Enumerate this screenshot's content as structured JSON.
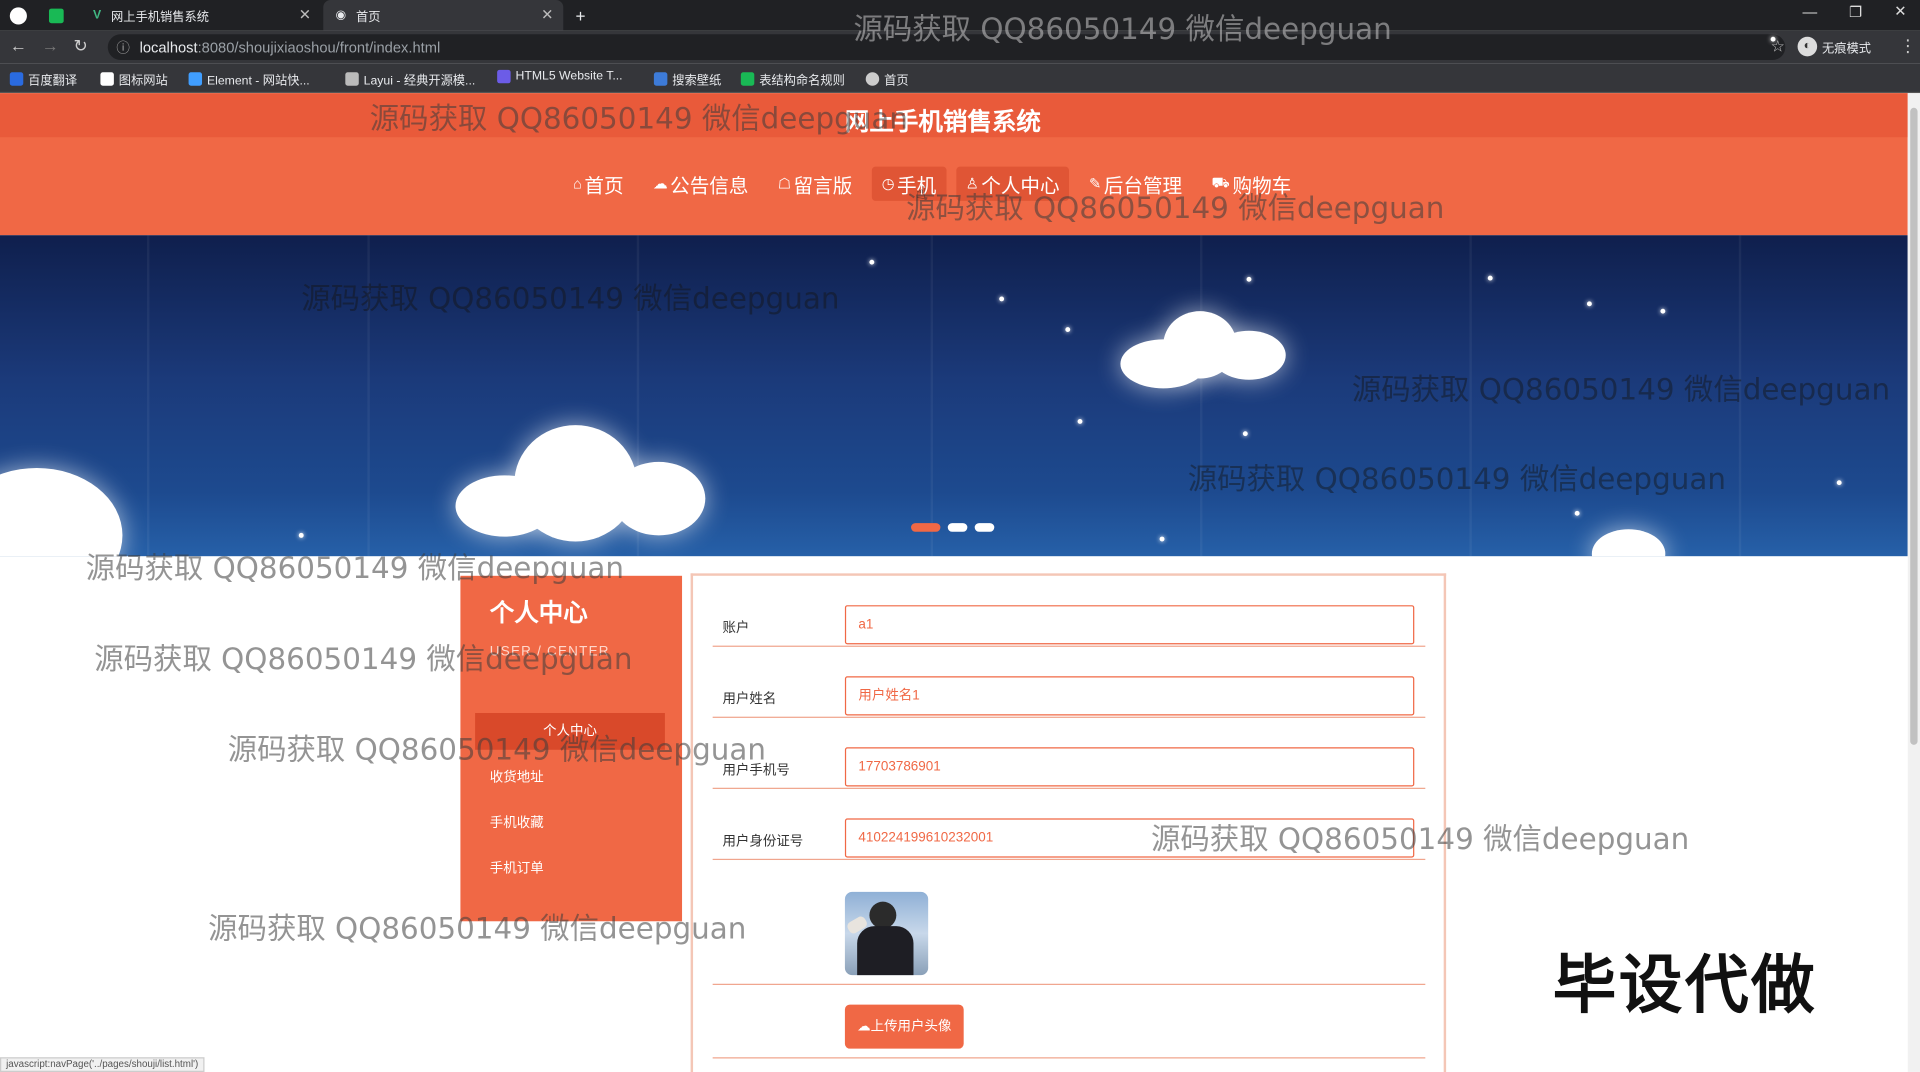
{
  "browser": {
    "tabs": [
      {
        "label": "网上手机销售系统"
      },
      {
        "label": "首页"
      }
    ],
    "new_tab": "+",
    "url_host": "localhost",
    "url_path": ":8080/shoujixiaoshou/front/index.html",
    "incognito_label": "无痕模式",
    "bookmarks": [
      {
        "label": "百度翻译",
        "color": "#2a6be0"
      },
      {
        "label": "图标网站",
        "color": "#ffffff"
      },
      {
        "label": "Element - 网站快...",
        "color": "#409eff"
      },
      {
        "label": "Layui - 经典开源模...",
        "color": "#bbbbbb"
      },
      {
        "label": "HTML5 Website T...",
        "color": "#6c5ce7"
      },
      {
        "label": "搜索壁纸",
        "color": "#3d7bd8"
      },
      {
        "label": "表结构命名规则",
        "color": "#19b955"
      },
      {
        "label": "首页",
        "color": "#cccccc"
      }
    ]
  },
  "site": {
    "title": "网上手机销售系统",
    "nav": [
      {
        "label": "首页",
        "icon": "home-icon",
        "glyph": "⌂"
      },
      {
        "label": "公告信息",
        "icon": "notice-icon",
        "glyph": "☁"
      },
      {
        "label": "留言版",
        "icon": "message-icon",
        "glyph": "☖"
      },
      {
        "label": "手机",
        "icon": "phone-icon",
        "glyph": "◷"
      },
      {
        "label": "个人中心",
        "icon": "user-icon",
        "glyph": "♙"
      },
      {
        "label": "后台管理",
        "icon": "admin-icon",
        "glyph": "✎"
      },
      {
        "label": "购物车",
        "icon": "cart-icon",
        "glyph": "⛟"
      }
    ]
  },
  "sidebar": {
    "title": "个人中心",
    "subtitle": "USER / CENTER",
    "items": [
      {
        "label": "个人中心"
      },
      {
        "label": "收货地址"
      },
      {
        "label": "手机收藏"
      },
      {
        "label": "手机订单"
      }
    ]
  },
  "form": {
    "fields": [
      {
        "label": "账户",
        "value": "a1"
      },
      {
        "label": "用户姓名",
        "value": "用户姓名1"
      },
      {
        "label": "用户手机号",
        "value": "17703786901"
      },
      {
        "label": "用户身份证号",
        "value": "410224199610232001"
      }
    ],
    "upload_label": "上传用户头像"
  },
  "status_text": "javascript:navPage('../pages/shouji/list.html')",
  "watermark": "源码获取 QQ86050149 微信deepguan",
  "stamp": "毕设代做",
  "colors": {
    "accent": "#f06845",
    "accent_dark": "#e95a3a"
  }
}
